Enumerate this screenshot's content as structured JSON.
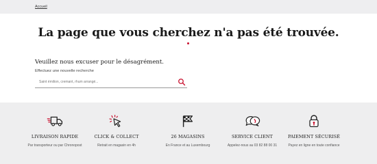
{
  "breadcrumb": {
    "home_label": "Accueil"
  },
  "title": "La page que vous cherchez n'a pas été trouvée.",
  "apology": "Veuillez nous excuser pour le désagrément.",
  "search": {
    "label": "Effectuez une nouvelle recherche",
    "placeholder": "Saint émilion, cremant, rhum arrangé..."
  },
  "accent_color": "#c8102e",
  "features": [
    {
      "icon": "delivery-truck-icon",
      "title": "Livraison rapide",
      "subtitle": "Par transporteur ou par Chronopost"
    },
    {
      "icon": "click-collect-cursor-icon",
      "title": "Click & Collect",
      "subtitle": "Retrait en magasin en 4h"
    },
    {
      "icon": "flag-icon",
      "title": "26 magasins",
      "subtitle": "En France et au Luxembourg"
    },
    {
      "icon": "chat-bubbles-icon",
      "title": "Service client",
      "subtitle": "Appelez-nous au 03 82 88 00 31"
    },
    {
      "icon": "padlock-icon",
      "title": "Paiement sécurisé",
      "subtitle": "Payez en ligne en toute confiance"
    }
  ]
}
